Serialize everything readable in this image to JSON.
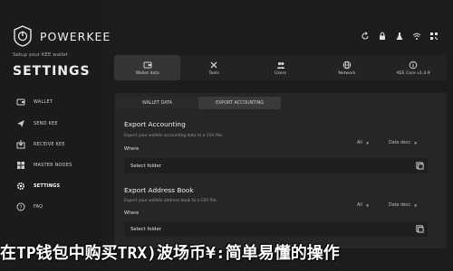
{
  "app": {
    "brand": "POWERKEE",
    "setup_text": "Setup your KEE wallet",
    "page_title": "SETTINGS"
  },
  "sidebar": {
    "items": [
      {
        "label": "WALLET",
        "icon": "wallet-icon"
      },
      {
        "label": "SEND KEE",
        "icon": "send-icon"
      },
      {
        "label": "RECEIVE KEE",
        "icon": "receive-icon"
      },
      {
        "label": "MASTER NODES",
        "icon": "nodes-icon"
      },
      {
        "label": "SETTINGS",
        "icon": "gear-icon",
        "active": true
      },
      {
        "label": "FAQ",
        "icon": "question-icon"
      }
    ]
  },
  "top_icons": [
    "refresh-icon",
    "lock-icon",
    "flask-icon",
    "wifi-icon",
    "qr-icon"
  ],
  "tabs": [
    {
      "label": "Wallet data",
      "icon": "wallet-data-icon",
      "active": true
    },
    {
      "label": "Tools",
      "icon": "tools-icon"
    },
    {
      "label": "Users",
      "icon": "users-icon"
    },
    {
      "label": "Network",
      "icon": "network-icon"
    },
    {
      "label": "KEE Core v1.4.9",
      "icon": "info-icon"
    }
  ],
  "subtabs": [
    {
      "label": "WALLET DATA",
      "active": false
    },
    {
      "label": "EXPORT ACCOUNTING",
      "active": true
    }
  ],
  "export_accounting": {
    "title": "Export Accounting",
    "description": "Export your wallets accounting data to a CSV file.",
    "where_label": "Where",
    "filter_value": "All",
    "sort_value": "Date desc",
    "folder_placeholder": "Select folder"
  },
  "export_address_book": {
    "title": "Export Address Book",
    "description": "Export your wallets address book to a CSV file.",
    "where_label": "Where",
    "filter_value": "All",
    "sort_value": "Date desc",
    "folder_placeholder": "Select folder"
  },
  "banner": {
    "text": "在TP钱包中购买TRX)波场币¥:简单易懂的操作"
  }
}
